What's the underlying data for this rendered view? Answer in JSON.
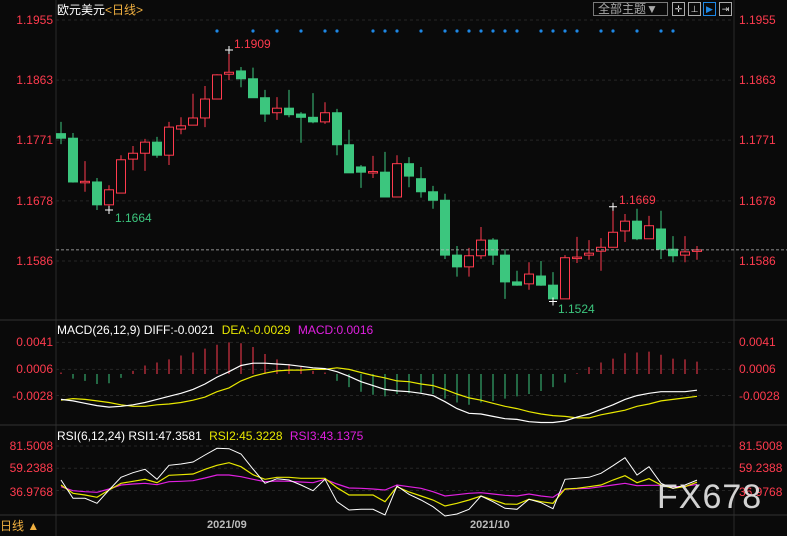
{
  "header": {
    "symbol": "欧元美元",
    "period": "<日线>",
    "theme_button": "全部主题▼",
    "icons": [
      "crosshair-icon",
      "range-select-icon",
      "play-forward-icon",
      "move-right-icon"
    ]
  },
  "colors": {
    "up": "#ff3b4e",
    "down": "#3cc67e",
    "diff": "#ffffff",
    "dea": "#e8e800",
    "macd": "#e020e0",
    "marker": "#1e88e5",
    "last_line": "#d8a050"
  },
  "price_axis": {
    "labels": [
      "1.1955",
      "1.1863",
      "1.1771",
      "1.1678",
      "1.1586"
    ],
    "values": [
      1.1955,
      1.1863,
      1.1771,
      1.1678,
      1.1586
    ]
  },
  "annotations": {
    "high": "1.1909",
    "low1": "1.1664",
    "low2": "1.1524",
    "high2": "1.1669"
  },
  "last_price": 1.1603,
  "event_marker_indices": [
    13,
    16,
    18,
    20,
    22,
    23,
    26,
    27,
    28,
    30,
    32,
    33,
    34,
    35,
    36,
    37,
    38,
    40,
    41,
    42,
    43,
    45,
    46,
    48,
    50,
    51
  ],
  "chart_data": {
    "type": "candlestick",
    "title": "欧元美元 日线",
    "x_labels": [
      {
        "index": 14,
        "label": "2021/09"
      },
      {
        "index": 36,
        "label": "2021/10"
      }
    ],
    "ohlc": [
      [
        1.1781,
        1.1799,
        1.1765,
        1.1774
      ],
      [
        1.1774,
        1.1782,
        1.1706,
        1.1707
      ],
      [
        1.1707,
        1.1739,
        1.1692,
        1.1708
      ],
      [
        1.1707,
        1.1713,
        1.1664,
        1.1672
      ],
      [
        1.1672,
        1.1702,
        1.1664,
        1.1695
      ],
      [
        1.169,
        1.1748,
        1.169,
        1.1741
      ],
      [
        1.1742,
        1.1762,
        1.1725,
        1.1751
      ],
      [
        1.1751,
        1.1773,
        1.1724,
        1.1768
      ],
      [
        1.1768,
        1.1776,
        1.1744,
        1.1748
      ],
      [
        1.1748,
        1.1799,
        1.1733,
        1.1791
      ],
      [
        1.1788,
        1.1806,
        1.178,
        1.1793
      ],
      [
        1.1794,
        1.1842,
        1.1794,
        1.1805
      ],
      [
        1.1805,
        1.1854,
        1.1791,
        1.1834
      ],
      [
        1.1834,
        1.1872,
        1.1834,
        1.1871
      ],
      [
        1.1872,
        1.1909,
        1.1863,
        1.1875
      ],
      [
        1.1877,
        1.1883,
        1.1852,
        1.1865
      ],
      [
        1.1865,
        1.1882,
        1.1836,
        1.1836
      ],
      [
        1.1836,
        1.1848,
        1.1799,
        1.1811
      ],
      [
        1.1813,
        1.1837,
        1.1802,
        1.182
      ],
      [
        1.182,
        1.1848,
        1.1806,
        1.181
      ],
      [
        1.1811,
        1.1814,
        1.1767,
        1.1806
      ],
      [
        1.1806,
        1.1843,
        1.1797,
        1.1799
      ],
      [
        1.1799,
        1.1829,
        1.1796,
        1.1813
      ],
      [
        1.1813,
        1.1819,
        1.1748,
        1.1764
      ],
      [
        1.1764,
        1.1787,
        1.1721,
        1.1721
      ],
      [
        1.173,
        1.1733,
        1.1698,
        1.1722
      ],
      [
        1.1722,
        1.1747,
        1.1713,
        1.1723
      ],
      [
        1.1722,
        1.1753,
        1.1684,
        1.1684
      ],
      [
        1.1684,
        1.1748,
        1.1684,
        1.1735
      ],
      [
        1.1735,
        1.1745,
        1.1699,
        1.1716
      ],
      [
        1.1712,
        1.173,
        1.1683,
        1.1692
      ],
      [
        1.1692,
        1.1701,
        1.1666,
        1.1679
      ],
      [
        1.1679,
        1.1689,
        1.1589,
        1.1595
      ],
      [
        1.1595,
        1.1609,
        1.1562,
        1.1577
      ],
      [
        1.1577,
        1.1606,
        1.1562,
        1.1594
      ],
      [
        1.1594,
        1.1638,
        1.1589,
        1.1618
      ],
      [
        1.1618,
        1.1621,
        1.158,
        1.1595
      ],
      [
        1.1595,
        1.1604,
        1.1528,
        1.1554
      ],
      [
        1.1554,
        1.1571,
        1.1548,
        1.1549
      ],
      [
        1.1551,
        1.1584,
        1.1542,
        1.1566
      ],
      [
        1.1563,
        1.1586,
        1.1548,
        1.1549
      ],
      [
        1.1549,
        1.1569,
        1.1524,
        1.1528
      ],
      [
        1.1528,
        1.1595,
        1.1528,
        1.1591
      ],
      [
        1.1592,
        1.1623,
        1.1583,
        1.1592
      ],
      [
        1.1595,
        1.1618,
        1.1588,
        1.1598
      ],
      [
        1.1601,
        1.1621,
        1.1571,
        1.1607
      ],
      [
        1.1607,
        1.1669,
        1.1607,
        1.163
      ],
      [
        1.1632,
        1.1658,
        1.1615,
        1.1647
      ],
      [
        1.1647,
        1.1666,
        1.1618,
        1.162
      ],
      [
        1.162,
        1.1655,
        1.162,
        1.164
      ],
      [
        1.1635,
        1.1663,
        1.1589,
        1.1604
      ],
      [
        1.1604,
        1.1624,
        1.1584,
        1.1594
      ],
      [
        1.1595,
        1.1624,
        1.1584,
        1.16
      ],
      [
        1.1603,
        1.1609,
        1.1588,
        1.1603
      ]
    ],
    "macd": {
      "label": "MACD(26,12,9)",
      "diff_label": "DIFF:-0.0021",
      "dea_label": "DEA:-0.0029",
      "macd_label": "MACD:0.0016",
      "axis_labels": [
        "0.0041",
        "0.0006",
        "-0.0028"
      ],
      "axis_values": [
        0.0041,
        0.0006,
        -0.0028
      ],
      "diff": [
        -0.0033,
        -0.0035,
        -0.0038,
        -0.0041,
        -0.0043,
        -0.0042,
        -0.004,
        -0.0037,
        -0.0033,
        -0.0029,
        -0.0025,
        -0.002,
        -0.0013,
        -0.0004,
        0.0003,
        0.0011,
        0.0014,
        0.0014,
        0.0013,
        0.0012,
        0.001,
        0.0008,
        0.0007,
        0.0003,
        -0.0003,
        -0.001,
        -0.0015,
        -0.002,
        -0.0022,
        -0.0023,
        -0.0025,
        -0.0028,
        -0.0036,
        -0.0045,
        -0.0051,
        -0.0052,
        -0.0055,
        -0.0058,
        -0.0059,
        -0.0062,
        -0.0063,
        -0.0063,
        -0.0061,
        -0.0056,
        -0.0052,
        -0.0046,
        -0.004,
        -0.0033,
        -0.0028,
        -0.0025,
        -0.0023,
        -0.0023,
        -0.0023,
        -0.0021
      ],
      "dea": [
        -0.0034,
        -0.0032,
        -0.0033,
        -0.0035,
        -0.0037,
        -0.004,
        -0.0042,
        -0.0042,
        -0.004,
        -0.0039,
        -0.0037,
        -0.0034,
        -0.003,
        -0.0023,
        -0.0018,
        -0.0009,
        -0.0003,
        0.0001,
        0.0004,
        0.0005,
        0.0005,
        0.0006,
        0.0006,
        0.0008,
        0.0006,
        0.0002,
        -0.0002,
        -0.0005,
        -0.0009,
        -0.001,
        -0.0013,
        -0.0015,
        -0.002,
        -0.0026,
        -0.0031,
        -0.0034,
        -0.0038,
        -0.0042,
        -0.0045,
        -0.0049,
        -0.0052,
        -0.0054,
        -0.0055,
        -0.0057,
        -0.0057,
        -0.0053,
        -0.005,
        -0.0047,
        -0.0042,
        -0.0039,
        -0.0035,
        -0.0033,
        -0.0031,
        -0.0029
      ],
      "hist": [
        0.0002,
        -0.0006,
        -0.0009,
        -0.0013,
        -0.0012,
        -0.0005,
        0.0004,
        0.0011,
        0.0015,
        0.0019,
        0.0024,
        0.0028,
        0.0033,
        0.0038,
        0.0041,
        0.004,
        0.0035,
        0.0026,
        0.0019,
        0.0013,
        0.0009,
        0.0004,
        0.0002,
        -0.0009,
        -0.0017,
        -0.0023,
        -0.0027,
        -0.0029,
        -0.0026,
        -0.0025,
        -0.0024,
        -0.0026,
        -0.0032,
        -0.0037,
        -0.004,
        -0.0037,
        -0.0035,
        -0.0032,
        -0.0029,
        -0.0026,
        -0.0022,
        -0.0017,
        -0.0011,
        0.0001,
        0.0009,
        0.0015,
        0.002,
        0.0027,
        0.0028,
        0.0029,
        0.0025,
        0.002,
        0.0019,
        0.0016
      ]
    },
    "rsi": {
      "label": "RSI(6,12,24)",
      "rsi1_label": "RSI1:47.3581",
      "rsi2_label": "RSI2:45.3228",
      "rsi3_label": "RSI3:43.1375",
      "axis_labels": [
        "81.5008",
        "59.2388",
        "36.9768"
      ],
      "axis_values": [
        81.5008,
        59.2388,
        36.9768
      ],
      "rsi1": [
        47.5,
        29.2,
        29.2,
        24.2,
        37.5,
        50.2,
        54.8,
        58.2,
        48.2,
        62.2,
        63.5,
        65.5,
        72.5,
        79.2,
        78.8,
        73.5,
        58.5,
        44.2,
        48.8,
        47.5,
        42.5,
        36.8,
        48.2,
        25.8,
        17.5,
        18.2,
        18.2,
        12.5,
        41.5,
        33.2,
        27.5,
        20.8,
        11.5,
        13.5,
        18.2,
        31.5,
        25.8,
        19.2,
        18.2,
        28.2,
        24.8,
        18.8,
        48.2,
        49.2,
        50.2,
        54.2,
        61.8,
        69.8,
        52.5,
        60.8,
        44.2,
        39.2,
        42.5,
        47.4
      ],
      "rsi2": [
        42.5,
        34.2,
        32.5,
        30.2,
        37.5,
        44.2,
        46.2,
        48.2,
        44.8,
        52.2,
        52.8,
        53.5,
        58.2,
        62.2,
        64.8,
        60.8,
        52.8,
        48.2,
        50.2,
        50.2,
        49.2,
        49.2,
        49.2,
        39.8,
        32.5,
        32.5,
        32.5,
        25.8,
        40.8,
        35.5,
        31.5,
        27.5,
        21.5,
        24.2,
        27.5,
        31.5,
        27.5,
        23.5,
        23.2,
        28.2,
        25.8,
        24.2,
        38.5,
        39.2,
        40.8,
        42.5,
        47.5,
        51.8,
        44.8,
        48.8,
        42.5,
        39.2,
        40.8,
        45.3
      ],
      "rsi3": [
        40.8,
        36.8,
        35.8,
        35.2,
        38.5,
        42.5,
        43.5,
        44.2,
        42.8,
        45.8,
        46.2,
        46.8,
        49.5,
        52.5,
        52.5,
        50.8,
        48.2,
        45.8,
        46.5,
        46.2,
        45.5,
        44.8,
        48.2,
        43.5,
        39.5,
        39.2,
        38.5,
        37.5,
        42.5,
        40.8,
        39.2,
        35.8,
        31.5,
        32.8,
        34.2,
        34.8,
        33.5,
        32.2,
        31.5,
        33.5,
        31.5,
        30.2,
        38.2,
        38.8,
        39.2,
        40.8,
        42.5,
        44.2,
        41.8,
        42.2,
        42.2,
        40.8,
        41.2,
        43.1
      ]
    }
  },
  "footer": {
    "period_button": "日线 ▲",
    "watermark": "FX678"
  }
}
